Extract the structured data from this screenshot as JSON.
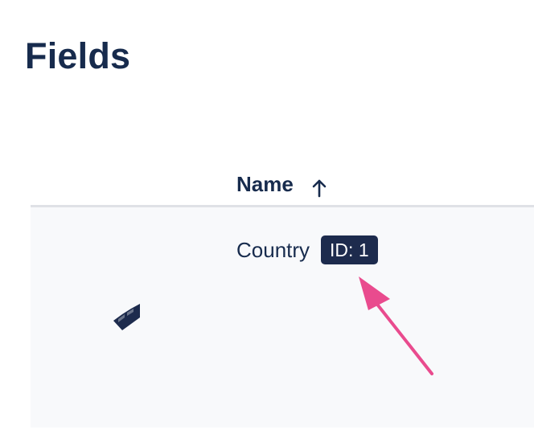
{
  "page": {
    "title": "Fields"
  },
  "table": {
    "columns": [
      {
        "label": "Name",
        "sort_icon": "arrow-up-icon"
      }
    ],
    "rows": [
      {
        "name": "Country",
        "id_badge": "ID: 1",
        "icon": "jira-logo-icon"
      }
    ]
  },
  "annotation": {
    "arrow_icon": "annotation-arrow-icon",
    "arrow_color": "#e94b8e"
  },
  "colors": {
    "text": "#172b4d",
    "badge_bg": "#1d2b4d",
    "row_bg": "#f8f9fb",
    "divider": "#dfe1e6"
  }
}
